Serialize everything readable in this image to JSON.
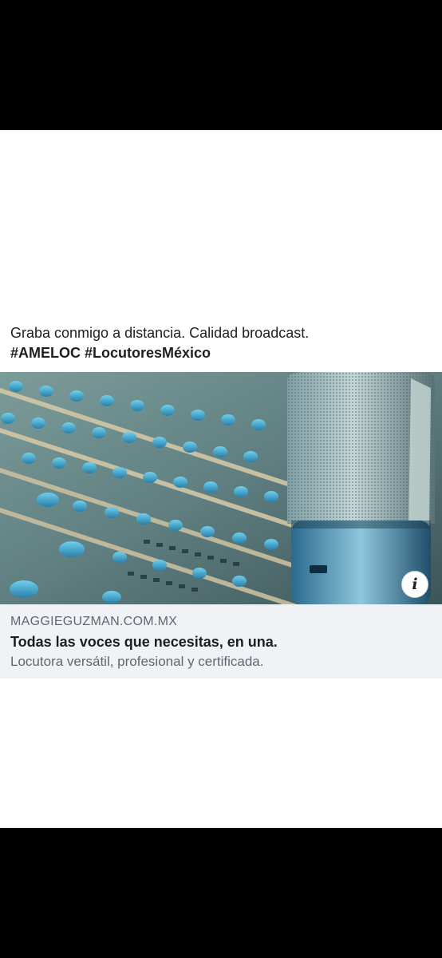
{
  "post": {
    "text": "Graba conmigo a distancia. Calidad broadcast.",
    "hashtags": "#AMELOC #LocutoresMéxico"
  },
  "ad_image": {
    "icon": "studio-microphone-mixer-image",
    "info_glyph": "i"
  },
  "link_card": {
    "domain": "MAGGIEGUZMAN.COM.MX",
    "title": "Todas las voces que necesitas, en una.",
    "description": "Locutora versátil, profesional y certificada."
  },
  "colors": {
    "card_background": "#f0f2f5",
    "text_primary": "#1c1e21",
    "text_secondary": "#606770"
  }
}
